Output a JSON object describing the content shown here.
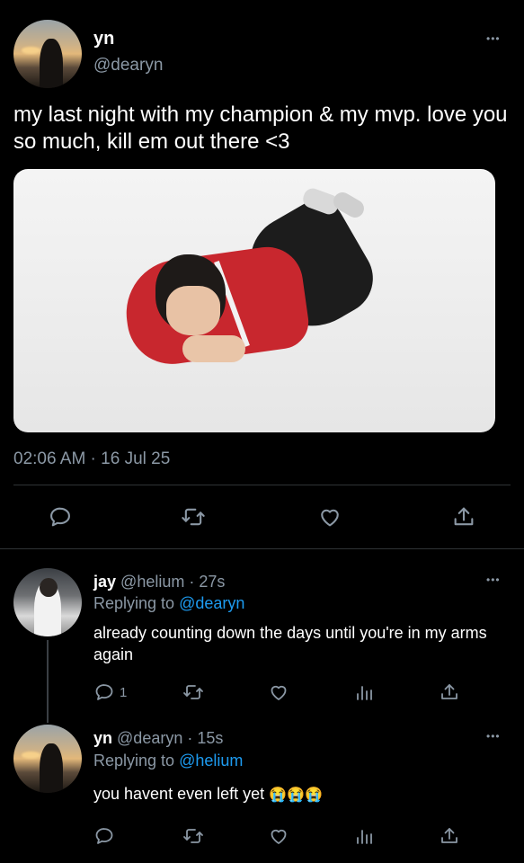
{
  "main_tweet": {
    "name": "yn",
    "handle": "@dearyn",
    "text": "my last night with my champion & my mvp. love you so much, kill em out there <3",
    "timestamp": "02:06 AM · 16 Jul 25",
    "more": "•••"
  },
  "replies": [
    {
      "name": "jay",
      "handle": "@helium",
      "time": "· 27s",
      "replying_label": "Replying to",
      "replying_to": "@dearyn",
      "text": "already counting down the days until you're in my arms again",
      "reply_count": "1",
      "more": "•••"
    },
    {
      "name": "yn",
      "handle": "@dearyn",
      "time": "· 15s",
      "replying_label": "Replying to",
      "replying_to": "@helium",
      "text": "you havent even left yet",
      "emojis": "😭😭😭",
      "more": "•••"
    }
  ],
  "icons": [
    "reply-icon",
    "retweet-icon",
    "like-icon",
    "analytics-icon",
    "share-icon",
    "more-icon"
  ],
  "colors": {
    "background": "#000000",
    "text": "#ffffff",
    "muted": "#8b98a5",
    "link": "#1d9bf0",
    "divider": "#2f3336"
  }
}
